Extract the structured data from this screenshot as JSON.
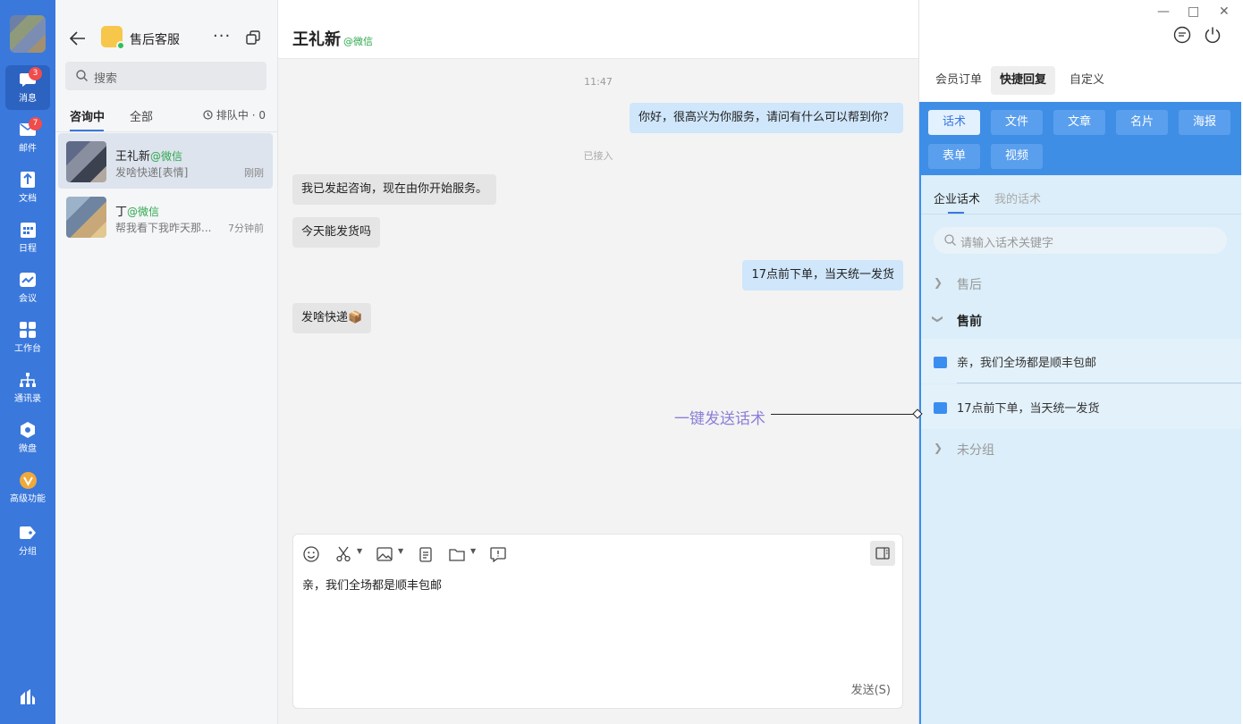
{
  "nav": {
    "items": [
      {
        "label": "消息",
        "icon": "chat-bubble-icon",
        "badge": "3",
        "active": true
      },
      {
        "label": "邮件",
        "icon": "mail-icon",
        "badge": "7"
      },
      {
        "label": "文档",
        "icon": "document-icon"
      },
      {
        "label": "日程",
        "icon": "calendar-icon"
      },
      {
        "label": "会议",
        "icon": "meeting-icon"
      },
      {
        "label": "工作台",
        "icon": "workbench-icon"
      },
      {
        "label": "通讯录",
        "icon": "org-chart-icon"
      },
      {
        "label": "微盘",
        "icon": "cloud-disk-icon"
      },
      {
        "label": "高级功能",
        "icon": "premium-icon"
      },
      {
        "label": "分组",
        "icon": "tag-icon"
      }
    ]
  },
  "session": {
    "service_name": "售后客服",
    "more_glyph": "···",
    "search_placeholder": "搜索",
    "tabs": [
      "咨询中",
      "全部"
    ],
    "queue_label": "排队中 · 0",
    "conversations": [
      {
        "name": "王礼新",
        "channel": "@微信",
        "preview": "发啥快递[表情]",
        "time": "刚刚",
        "active": true
      },
      {
        "name": "丁",
        "channel": "@微信",
        "preview": "帮我看下我昨天那...",
        "time": "7分钟前"
      }
    ]
  },
  "chat": {
    "title": "王礼新",
    "channel": "@微信",
    "timestamp": "11:47",
    "system_note": "已接入",
    "messages": [
      {
        "dir": "out",
        "text": "你好，很高兴为你服务，请问有什么可以帮到你？"
      },
      {
        "dir": "in",
        "text": "我已发起咨询，现在由你开始服务。"
      },
      {
        "dir": "in",
        "text": "今天能发货吗"
      },
      {
        "dir": "out",
        "text": "17点前下单，当天统一发货"
      },
      {
        "dir": "in",
        "text": "发啥快递📦"
      }
    ],
    "draft": "亲，我们全场都是顺丰包邮",
    "send_label": "发送(S)"
  },
  "right": {
    "window_controls": [
      "—",
      "□",
      "✕"
    ],
    "tabs": [
      "会员订单",
      "快捷回复",
      "自定义"
    ],
    "active_tab": "快捷回复",
    "chips": [
      "话术",
      "文件",
      "文章",
      "名片",
      "海报",
      "表单",
      "视频"
    ],
    "sub_tabs": [
      "企业话术",
      "我的话术"
    ],
    "keyword_placeholder": "请输入话术关键字",
    "groups": {
      "after_sale": "售后",
      "pre_sale": "售前",
      "ungrouped": "未分组"
    },
    "phrases": [
      "亲，我们全场都是顺丰包邮",
      "17点前下单，当天统一发货"
    ]
  },
  "annotation": {
    "text": "一键发送话术"
  },
  "colors": {
    "nav_bg": "#3a78dc",
    "accent": "#3a8ef0",
    "panel_bg": "#dbeef9",
    "wechat_green": "#2fa84f",
    "badge_red": "#f04c4c"
  }
}
